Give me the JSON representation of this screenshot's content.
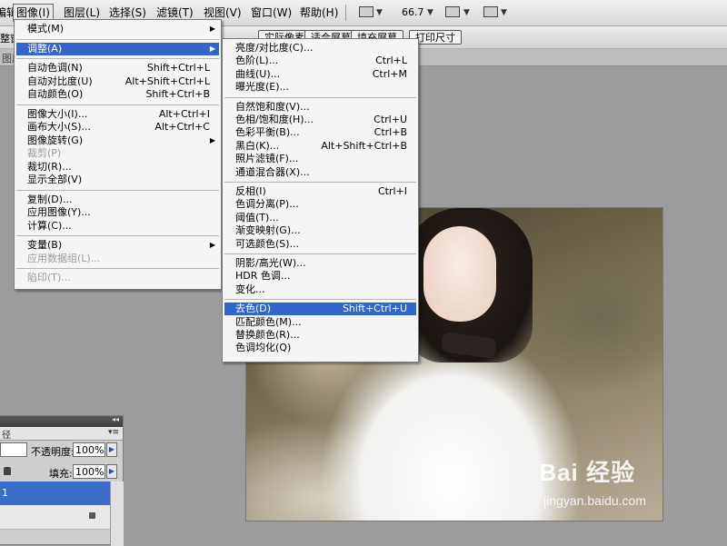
{
  "menubar": {
    "items": [
      {
        "label": "编辑(E)",
        "active": false
      },
      {
        "label": "图像(I)",
        "active": true
      },
      {
        "label": "图层(L)",
        "active": false
      },
      {
        "label": "选择(S)",
        "active": false
      },
      {
        "label": "滤镜(T)",
        "active": false
      },
      {
        "label": "视图(V)",
        "active": false
      },
      {
        "label": "窗口(W)",
        "active": false
      },
      {
        "label": "帮助(H)",
        "active": false
      }
    ],
    "zoom": "66.7",
    "dropdown_glyph": "▼"
  },
  "options_bar": {
    "clipped_label": "整窗",
    "buttons": [
      "实际像素",
      "适合屏幕",
      "填充屏幕",
      "打印尺寸"
    ]
  },
  "tab_strip": {
    "label": "图层"
  },
  "image_menu": {
    "items": [
      {
        "label": "模式(M)",
        "shortcut": "",
        "submenu": true,
        "disabled": false,
        "highlighted": false
      },
      {
        "sep": true
      },
      {
        "label": "调整(A)",
        "shortcut": "",
        "submenu": true,
        "disabled": false,
        "highlighted": true
      },
      {
        "sep": true
      },
      {
        "label": "自动色调(N)",
        "shortcut": "Shift+Ctrl+L",
        "submenu": false,
        "disabled": false,
        "highlighted": false
      },
      {
        "label": "自动对比度(U)",
        "shortcut": "Alt+Shift+Ctrl+L",
        "submenu": false,
        "disabled": false,
        "highlighted": false
      },
      {
        "label": "自动颜色(O)",
        "shortcut": "Shift+Ctrl+B",
        "submenu": false,
        "disabled": false,
        "highlighted": false
      },
      {
        "sep": true
      },
      {
        "label": "图像大小(I)...",
        "shortcut": "Alt+Ctrl+I",
        "submenu": false,
        "disabled": false,
        "highlighted": false
      },
      {
        "label": "画布大小(S)...",
        "shortcut": "Alt+Ctrl+C",
        "submenu": false,
        "disabled": false,
        "highlighted": false
      },
      {
        "label": "图像旋转(G)",
        "shortcut": "",
        "submenu": true,
        "disabled": false,
        "highlighted": false
      },
      {
        "label": "裁剪(P)",
        "shortcut": "",
        "submenu": false,
        "disabled": true,
        "highlighted": false
      },
      {
        "label": "裁切(R)...",
        "shortcut": "",
        "submenu": false,
        "disabled": false,
        "highlighted": false
      },
      {
        "label": "显示全部(V)",
        "shortcut": "",
        "submenu": false,
        "disabled": false,
        "highlighted": false
      },
      {
        "sep": true
      },
      {
        "label": "复制(D)...",
        "shortcut": "",
        "submenu": false,
        "disabled": false,
        "highlighted": false
      },
      {
        "label": "应用图像(Y)...",
        "shortcut": "",
        "submenu": false,
        "disabled": false,
        "highlighted": false
      },
      {
        "label": "计算(C)...",
        "shortcut": "",
        "submenu": false,
        "disabled": false,
        "highlighted": false
      },
      {
        "sep": true
      },
      {
        "label": "变量(B)",
        "shortcut": "",
        "submenu": true,
        "disabled": false,
        "highlighted": false
      },
      {
        "label": "应用数据组(L)...",
        "shortcut": "",
        "submenu": false,
        "disabled": true,
        "highlighted": false
      },
      {
        "sep": true
      },
      {
        "label": "陷印(T)...",
        "shortcut": "",
        "submenu": false,
        "disabled": true,
        "highlighted": false
      }
    ]
  },
  "adjust_menu": {
    "items": [
      {
        "label": "亮度/对比度(C)...",
        "shortcut": "",
        "highlighted": false
      },
      {
        "label": "色阶(L)...",
        "shortcut": "Ctrl+L",
        "highlighted": false
      },
      {
        "label": "曲线(U)...",
        "shortcut": "Ctrl+M",
        "highlighted": false
      },
      {
        "label": "曝光度(E)...",
        "shortcut": "",
        "highlighted": false
      },
      {
        "sep": true
      },
      {
        "label": "自然饱和度(V)...",
        "shortcut": "",
        "highlighted": false
      },
      {
        "label": "色相/饱和度(H)...",
        "shortcut": "Ctrl+U",
        "highlighted": false
      },
      {
        "label": "色彩平衡(B)...",
        "shortcut": "Ctrl+B",
        "highlighted": false
      },
      {
        "label": "黑白(K)...",
        "shortcut": "Alt+Shift+Ctrl+B",
        "highlighted": false
      },
      {
        "label": "照片滤镜(F)...",
        "shortcut": "",
        "highlighted": false
      },
      {
        "label": "通道混合器(X)...",
        "shortcut": "",
        "highlighted": false
      },
      {
        "sep": true
      },
      {
        "label": "反相(I)",
        "shortcut": "Ctrl+I",
        "highlighted": false
      },
      {
        "label": "色调分离(P)...",
        "shortcut": "",
        "highlighted": false
      },
      {
        "label": "阈值(T)...",
        "shortcut": "",
        "highlighted": false
      },
      {
        "label": "渐变映射(G)...",
        "shortcut": "",
        "highlighted": false
      },
      {
        "label": "可选颜色(S)...",
        "shortcut": "",
        "highlighted": false
      },
      {
        "sep": true
      },
      {
        "label": "阴影/高光(W)...",
        "shortcut": "",
        "highlighted": false
      },
      {
        "label": "HDR 色调...",
        "shortcut": "",
        "highlighted": false
      },
      {
        "label": "变化...",
        "shortcut": "",
        "highlighted": false
      },
      {
        "sep": true
      },
      {
        "label": "去色(D)",
        "shortcut": "Shift+Ctrl+U",
        "highlighted": true
      },
      {
        "label": "匹配颜色(M)...",
        "shortcut": "",
        "highlighted": false
      },
      {
        "label": "替换颜色(R)...",
        "shortcut": "",
        "highlighted": false
      },
      {
        "label": "色调均化(Q)",
        "shortcut": "",
        "highlighted": false
      }
    ]
  },
  "layers_panel": {
    "tab_label": "径",
    "opacity_label": "不透明度:",
    "opacity_value": "100%",
    "fill_label": "填充:",
    "fill_value": "100%",
    "selected_layer": "1",
    "collapse_glyph": "◂◂",
    "menu_glyph": "▾≡",
    "arrow_glyph": "▶"
  },
  "watermark": {
    "brand": "Bai 经验",
    "url": "jingyan.baidu.com"
  },
  "colors": {
    "highlight": "#3366cc",
    "menu_bg": "#f5f5f5",
    "workspace": "#9c9c9c"
  },
  "submenu_arrow": "▶"
}
